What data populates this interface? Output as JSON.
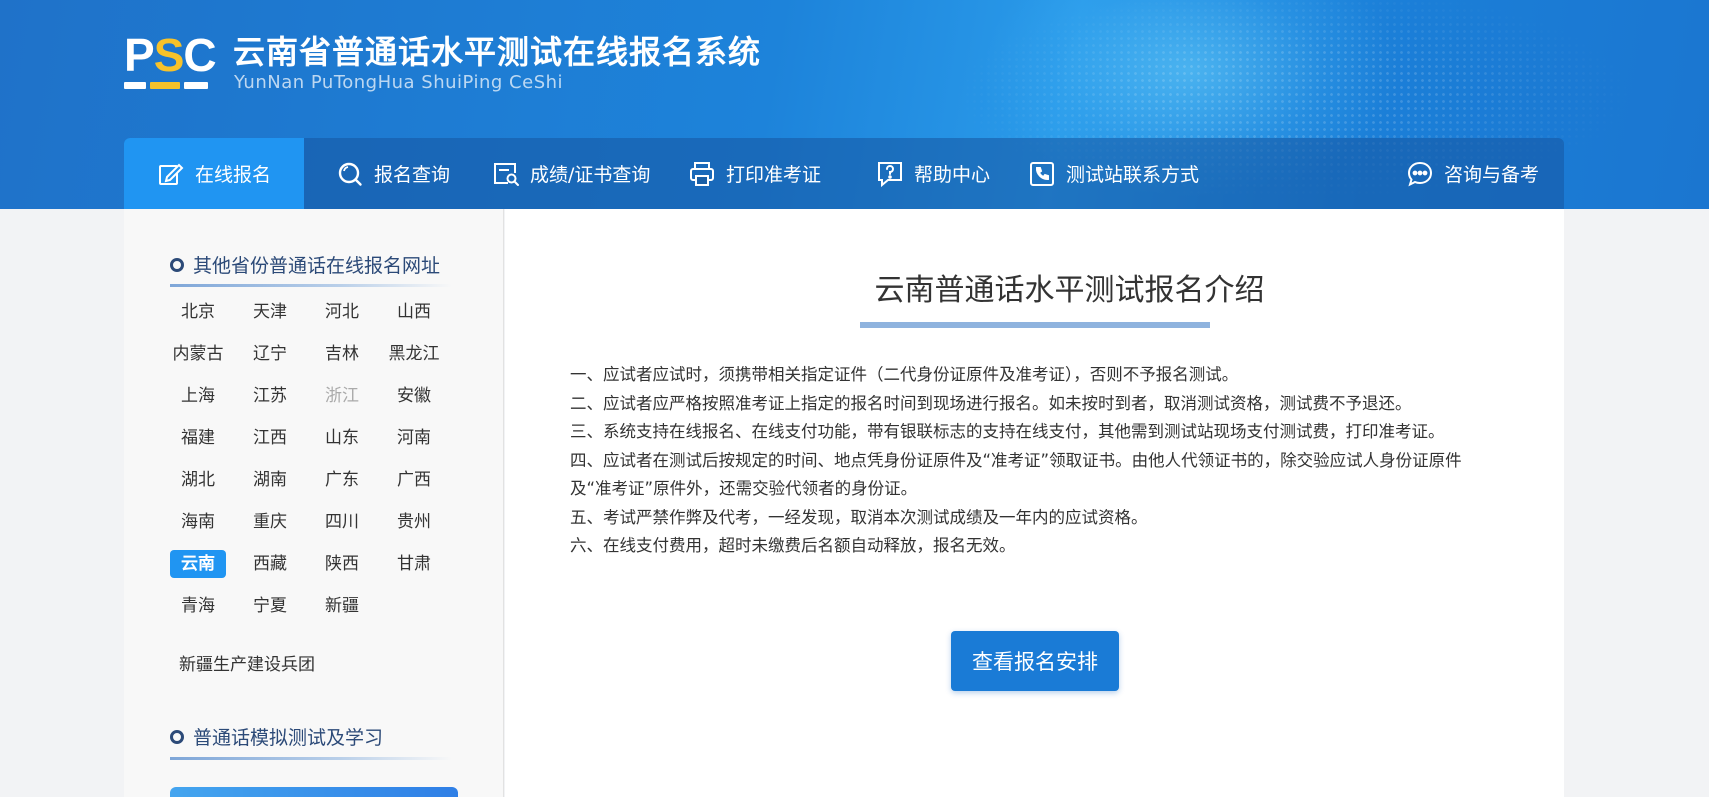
{
  "header": {
    "logo_text": "PSC",
    "title": "云南省普通话水平测试在线报名系统",
    "subtitle": "YunNan PuTongHua ShuiPing CeShi"
  },
  "nav": {
    "items": [
      {
        "label": "在线报名",
        "icon": "edit-icon",
        "active": true
      },
      {
        "label": "报名查询",
        "icon": "search-icon"
      },
      {
        "label": "成绩/证书查询",
        "icon": "certificate-search-icon"
      },
      {
        "label": "打印准考证",
        "icon": "printer-icon"
      },
      {
        "label": "帮助中心",
        "icon": "help-icon"
      },
      {
        "label": "测试站联系方式",
        "icon": "phone-icon"
      },
      {
        "label": "咨询与备考",
        "icon": "chat-icon"
      }
    ]
  },
  "sidebar": {
    "provinces_title": "其他省份普通话在线报名网址",
    "provinces": [
      "北京",
      "天津",
      "河北",
      "山西",
      "内蒙古",
      "辽宁",
      "吉林",
      "黑龙江",
      "上海",
      "江苏",
      "浙江",
      "安徽",
      "福建",
      "江西",
      "山东",
      "河南",
      "湖北",
      "湖南",
      "广东",
      "广西",
      "海南",
      "重庆",
      "四川",
      "贵州",
      "云南",
      "西藏",
      "陕西",
      "甘肃",
      "青海",
      "宁夏",
      "新疆"
    ],
    "disabled_province": "浙江",
    "selected_province": "云南",
    "bingtuan": "新疆生产建设兵团",
    "study_title": "普通话模拟测试及学习"
  },
  "main": {
    "title": "云南普通话水平测试报名介绍",
    "rules": [
      "一、应试者应试时，须携带相关指定证件（二代身份证原件及准考证），否则不予报名测试。",
      "二、应试者应严格按照准考证上指定的报名时间到现场进行报名。如未按时到者，取消测试资格，测试费不予退还。",
      "三、系统支持在线报名、在线支付功能，带有银联标志的支持在线支付，其他需到测试站现场支付测试费，打印准考证。",
      "四、应试者在测试后按规定的时间、地点凭身份证原件及“准考证”领取证书。由他人代领证书的，除交验应试人身份证原件及“准考证”原件外，还需交验代领者的身份证。",
      "五、考试严禁作弊及代考，一经发现，取消本次测试成绩及一年内的应试资格。",
      "六、在线支付费用，超时未缴费后名额自动释放，报名无效。"
    ],
    "cta_label": "查看报名安排"
  },
  "colors": {
    "accent": "#2095f2",
    "button": "#1a7bd6",
    "section_title": "#2c4a78"
  }
}
